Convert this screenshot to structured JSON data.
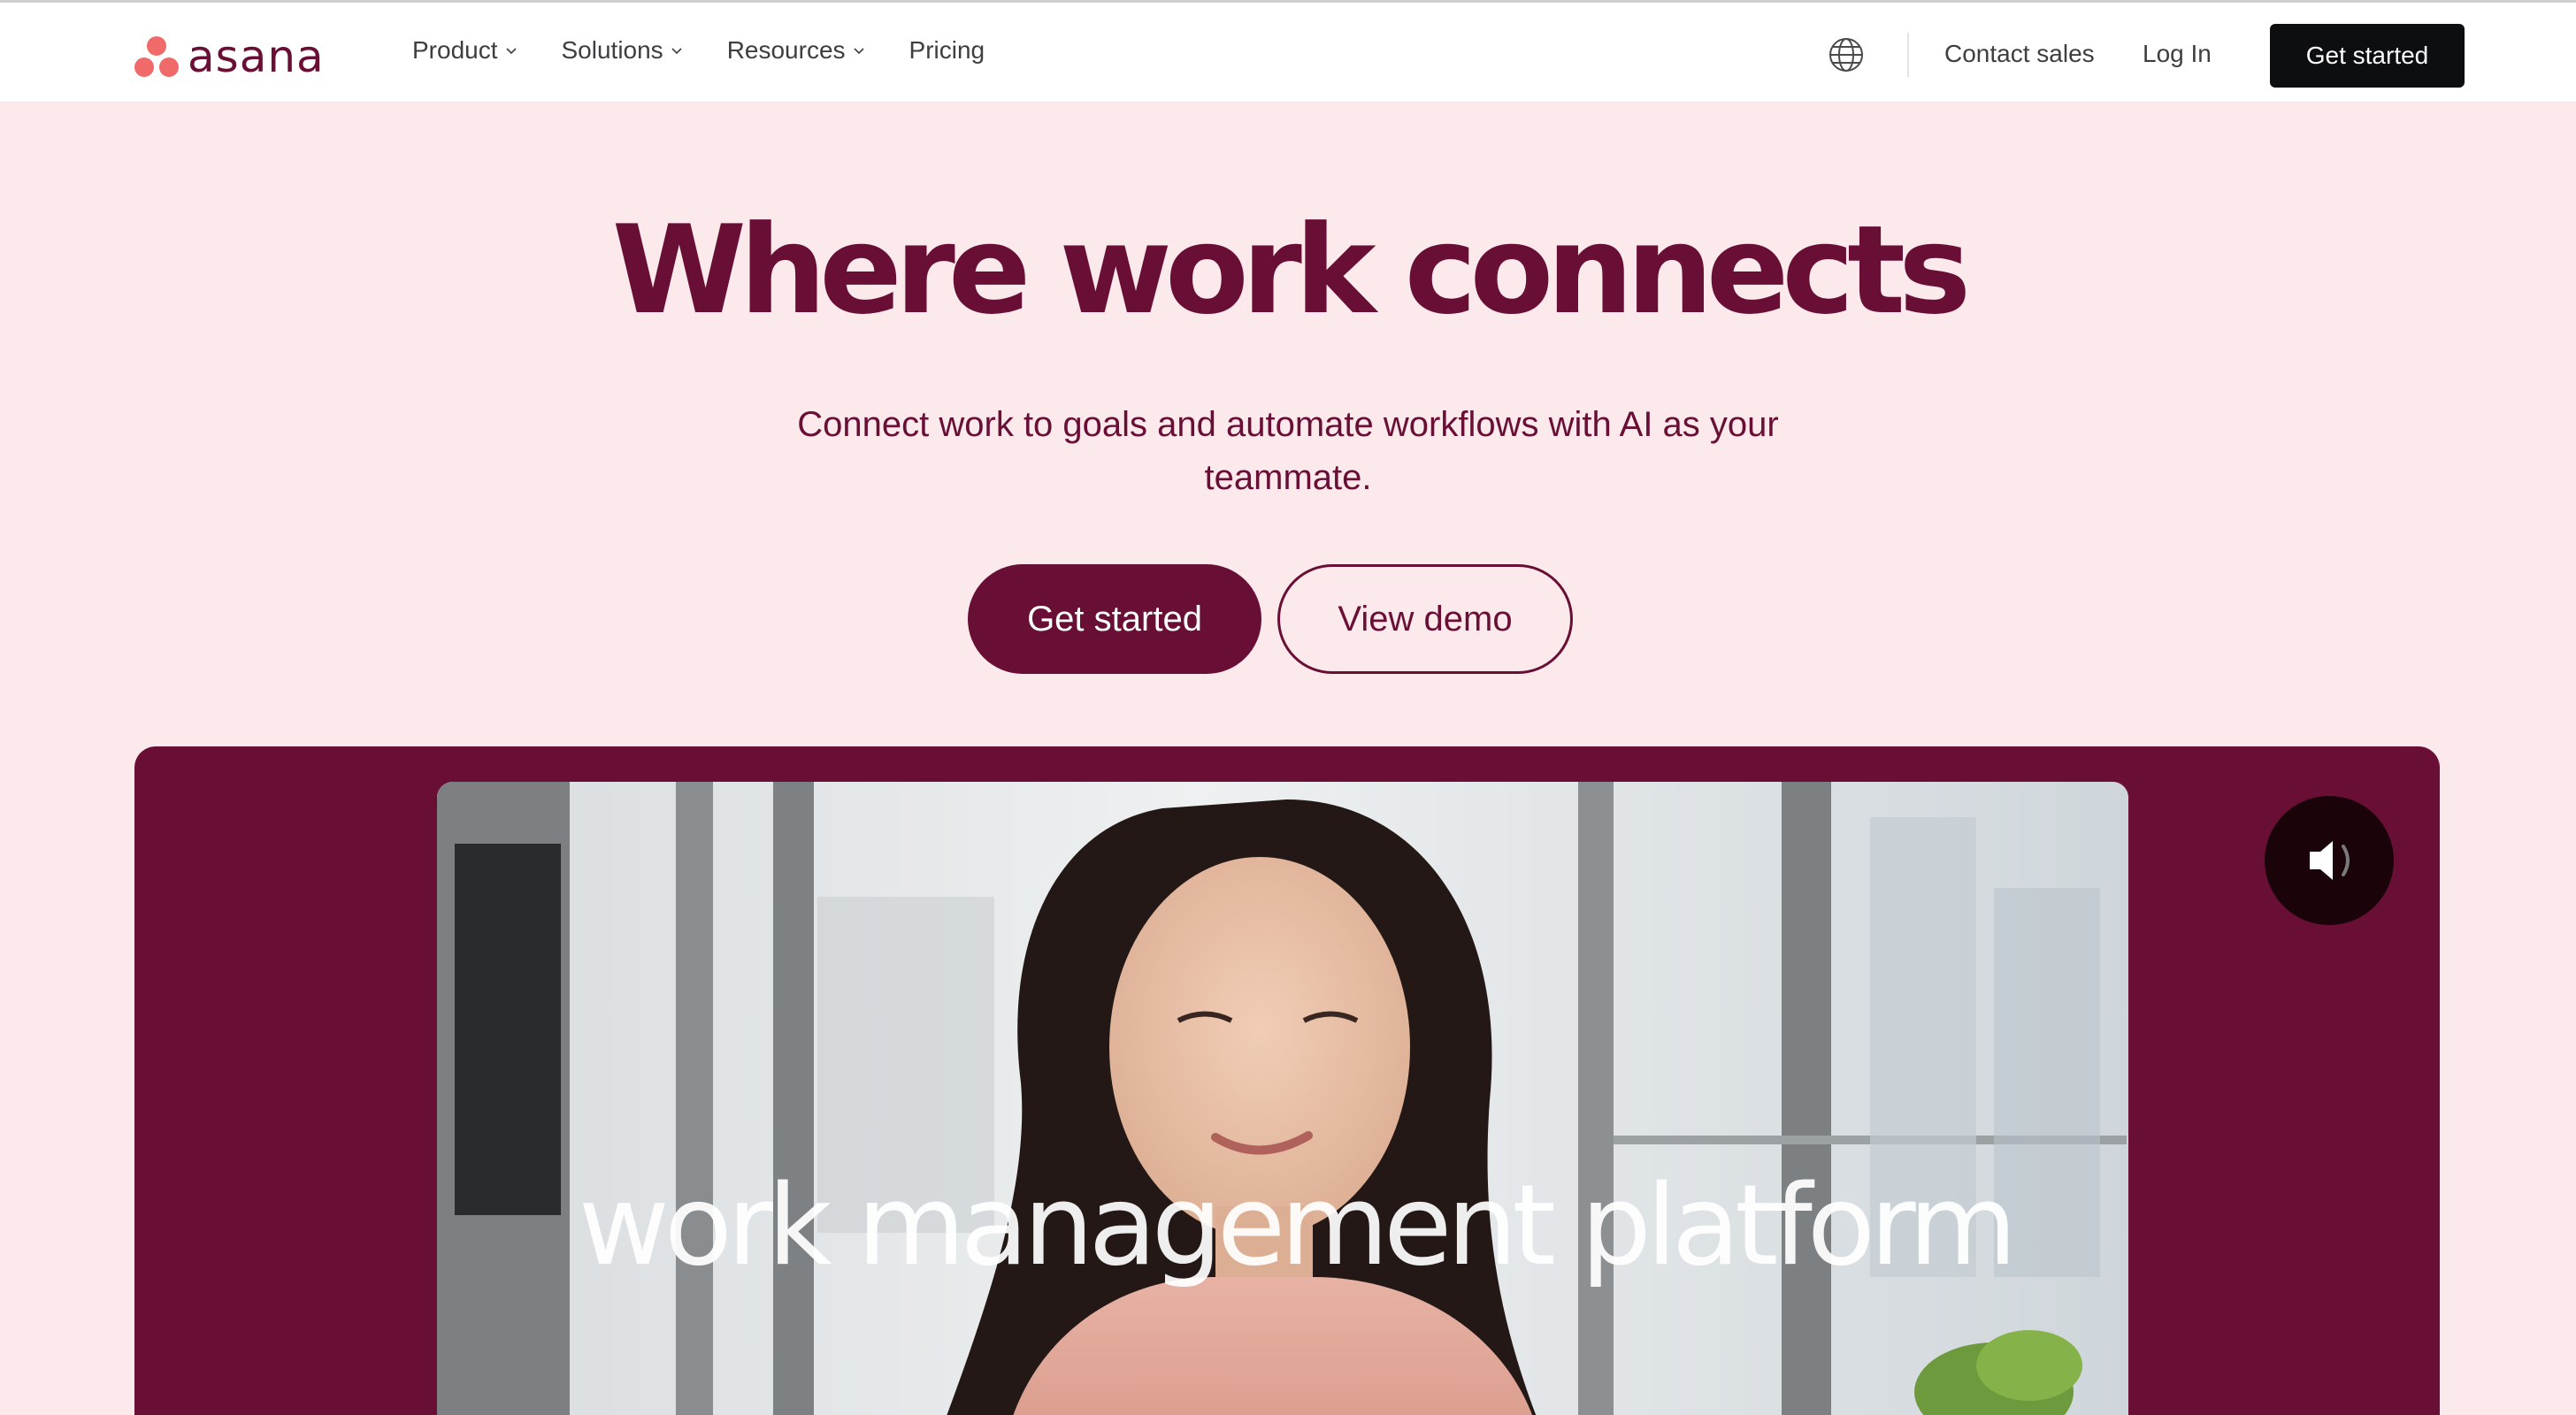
{
  "header": {
    "logo_text": "asana",
    "logo_color": "#f06a6a",
    "nav": [
      {
        "label": "Product",
        "icon": "chevron-down-icon"
      },
      {
        "label": "Solutions",
        "icon": "chevron-down-icon"
      },
      {
        "label": "Resources",
        "icon": "chevron-down-icon"
      },
      {
        "label": "Pricing"
      }
    ],
    "globe_icon": "globe-icon",
    "contact_label": "Contact sales",
    "login_label": "Log In",
    "cta_label": "Get started"
  },
  "hero": {
    "title": "Where work connects",
    "subtitle_line1": "Connect work to goals and automate workflows with AI as your",
    "subtitle_line2": "teammate.",
    "primary_cta": "Get started",
    "secondary_cta": "View demo"
  },
  "video": {
    "caption": "work management platform",
    "mute_icon": "volume-icon"
  },
  "colors": {
    "brand": "#690f35",
    "background": "#fbe9eb",
    "header_bg": "#ffffff",
    "header_cta_bg": "#0d0e10",
    "logo_coral": "#f06a6a"
  }
}
